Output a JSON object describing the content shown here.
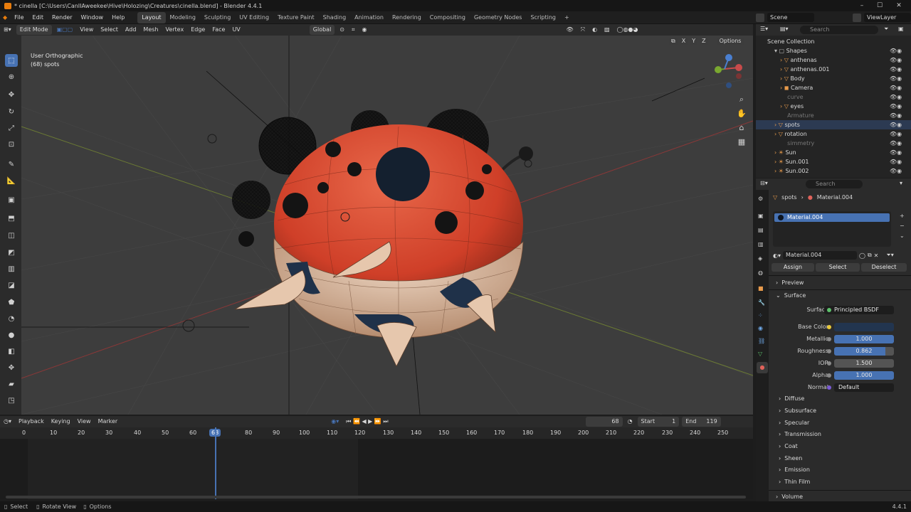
{
  "window_title": "* cinella [C:\\Users\\CanIIAweekee\\Hive\\Holozing\\Creatures\\cinella.blend] - Blender 4.4.1",
  "menu": [
    "File",
    "Edit",
    "Render",
    "Window",
    "Help"
  ],
  "workspaces": [
    "Layout",
    "Modeling",
    "Sculpting",
    "UV Editing",
    "Texture Paint",
    "Shading",
    "Animation",
    "Rendering",
    "Compositing",
    "Geometry Nodes",
    "Scripting"
  ],
  "scene": {
    "label": "Scene",
    "view_layer": "ViewLayer"
  },
  "viewport_header": {
    "mode": "Edit Mode",
    "menus": [
      "View",
      "Select",
      "Add",
      "Mesh",
      "Vertex",
      "Edge",
      "Face",
      "UV"
    ],
    "orientation": "Global",
    "options": "Options"
  },
  "viewport": {
    "view_name": "User Orthographic",
    "object_info": "(68) spots",
    "axes": [
      "X",
      "Y",
      "Z"
    ]
  },
  "timeline": {
    "menus": [
      "Playback",
      "Keying",
      "View",
      "Marker"
    ],
    "current_frame": "68",
    "start_label": "Start",
    "start": "1",
    "end_label": "End",
    "end": "119",
    "ruler": [
      "0",
      "10",
      "20",
      "30",
      "40",
      "50",
      "60",
      "68",
      "80",
      "90",
      "100",
      "110",
      "120",
      "130",
      "140",
      "150",
      "160",
      "170",
      "180",
      "190",
      "200",
      "210",
      "220",
      "230",
      "240",
      "250"
    ]
  },
  "outliner": {
    "search": "Search",
    "root": "Scene Collection",
    "items": [
      {
        "label": "Shapes",
        "kind": "collection"
      },
      {
        "label": "anthenas",
        "kind": "obj"
      },
      {
        "label": "anthenas.001",
        "kind": "obj"
      },
      {
        "label": "Body",
        "kind": "obj"
      },
      {
        "label": "Camera",
        "kind": "cam"
      },
      {
        "label": "curve",
        "kind": "dim"
      },
      {
        "label": "eyes",
        "kind": "obj"
      },
      {
        "label": "Armature",
        "kind": "dim"
      },
      {
        "label": "spots",
        "kind": "obj"
      },
      {
        "label": "rotation",
        "kind": "obj"
      },
      {
        "label": "simmetry",
        "kind": "dim"
      },
      {
        "label": "Sun",
        "kind": "light"
      },
      {
        "label": "Sun.001",
        "kind": "light"
      },
      {
        "label": "Sun.002",
        "kind": "light"
      }
    ]
  },
  "properties": {
    "search": "Search",
    "breadcrumb_object": "spots",
    "breadcrumb_material": "Material.004",
    "slot": "Material.004",
    "material_name": "Material.004",
    "buttons": [
      "Assign",
      "Select",
      "Deselect"
    ],
    "panels": {
      "preview": "Preview",
      "surface": "Surface"
    },
    "surface_label": "Surface",
    "surface_value": "Principled BSDF",
    "fields": [
      {
        "label": "Base Color",
        "value": ""
      },
      {
        "label": "Metallic",
        "value": "1.000"
      },
      {
        "label": "Roughness",
        "value": "0.862"
      },
      {
        "label": "IOR",
        "value": "1.500"
      },
      {
        "label": "Alpha",
        "value": "1.000"
      },
      {
        "label": "Normal",
        "value": "Default"
      }
    ],
    "subpanels": [
      "Diffuse",
      "Subsurface",
      "Specular",
      "Transmission",
      "Coat",
      "Sheen",
      "Emission",
      "Thin Film"
    ],
    "volume": "Volume"
  },
  "status": {
    "items": [
      "Select",
      "Rotate View",
      "Options"
    ],
    "version": "4.4.1"
  },
  "colors": {
    "accent": "#4772b3",
    "viewport_bg": "#3d3d3d",
    "body_red": "#d1442c",
    "underside": "#cda486",
    "dark_blue": "#1f3149"
  }
}
